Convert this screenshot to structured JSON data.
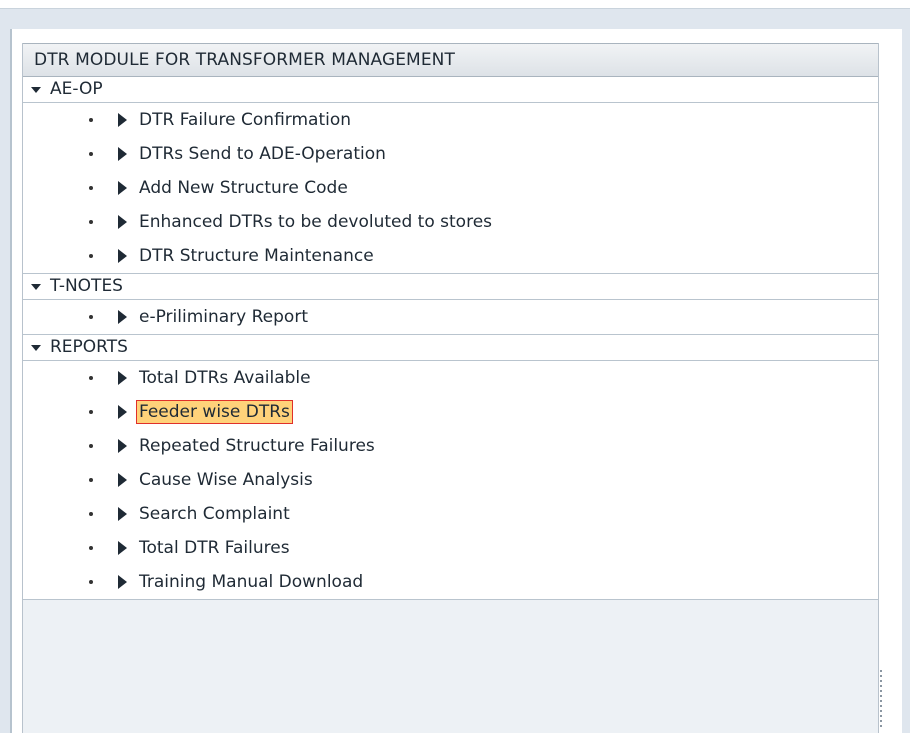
{
  "tree": {
    "header": "DTR MODULE FOR TRANSFORMER MANAGEMENT",
    "folders": [
      {
        "label": "AE-OP",
        "items": [
          "DTR Failure Confirmation",
          "DTRs Send to ADE-Operation",
          "Add New Structure Code",
          "Enhanced DTRs to be devoluted to stores",
          "DTR Structure Maintenance"
        ]
      },
      {
        "label": "T-NOTES",
        "items": [
          "e-Priliminary Report"
        ]
      },
      {
        "label": "REPORTS",
        "items": [
          "Total DTRs Available",
          "Feeder wise DTRs",
          "Repeated Structure Failures",
          "Cause Wise Analysis",
          "Search Complaint",
          "Total DTR Failures",
          "Training Manual Download"
        ]
      }
    ],
    "selected_item": "Feeder wise DTRs"
  },
  "colors": {
    "selection_bg": "#ffd27a",
    "selection_border": "#e0302a"
  }
}
